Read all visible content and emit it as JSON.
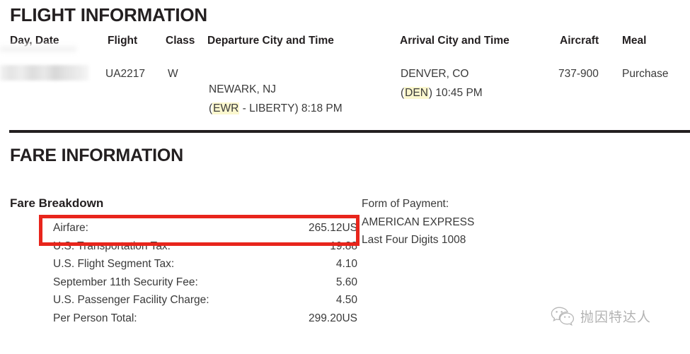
{
  "flight_section": {
    "title": "FLIGHT INFORMATION",
    "columns": [
      {
        "key": "day_date",
        "label": "Day, Date"
      },
      {
        "key": "flight",
        "label": "Flight"
      },
      {
        "key": "class",
        "label": "Class"
      },
      {
        "key": "departure",
        "label": "Departure City and Time"
      },
      {
        "key": "arrival",
        "label": "Arrival City and Time"
      },
      {
        "key": "aircraft",
        "label": "Aircraft"
      },
      {
        "key": "meal",
        "label": "Meal"
      }
    ],
    "row": {
      "day_date": "",
      "day_date_redacted": true,
      "flight": "UA2217",
      "class": "W",
      "departure_city": "NEWARK, NJ",
      "departure_code": "EWR",
      "departure_airport_name": "LIBERTY",
      "departure_paren_open": "(",
      "departure_dash": " - ",
      "departure_paren_close": ") ",
      "departure_time": "8:18 PM",
      "arrival_city": "DENVER, CO",
      "arrival_code": "DEN",
      "arrival_paren_open": "(",
      "arrival_paren_close": ") ",
      "arrival_time": "10:45 PM",
      "aircraft": "737-900",
      "meal": "Purchase"
    }
  },
  "fare_section": {
    "title": "FARE INFORMATION",
    "breakdown_heading": "Fare Breakdown",
    "rows": [
      {
        "label": "Airfare:",
        "value": "265.12US",
        "highlighted": true
      },
      {
        "label": "U.S. Transportation Tax:",
        "value": "19.88",
        "highlighted": false
      },
      {
        "label": "U.S. Flight Segment Tax:",
        "value": "4.10",
        "highlighted": false
      },
      {
        "label": "September 11th Security Fee:",
        "value": "5.60",
        "highlighted": false
      },
      {
        "label": "U.S. Passenger Facility Charge:",
        "value": "4.50",
        "highlighted": false
      },
      {
        "label": "Per Person Total:",
        "value": "299.20US",
        "highlighted": false
      }
    ]
  },
  "payment": {
    "label": "Form of Payment:",
    "card_type": "AMERICAN EXPRESS",
    "last_four": "Last Four Digits 1008"
  },
  "watermark": {
    "icon": "wechat-icon",
    "text": "抛因特达人"
  },
  "colors": {
    "annotation_red": "#e8251c",
    "highlight_yellow": "#fbf7ce",
    "text_dark": "#231f20",
    "text_body": "#3a3a3a"
  }
}
